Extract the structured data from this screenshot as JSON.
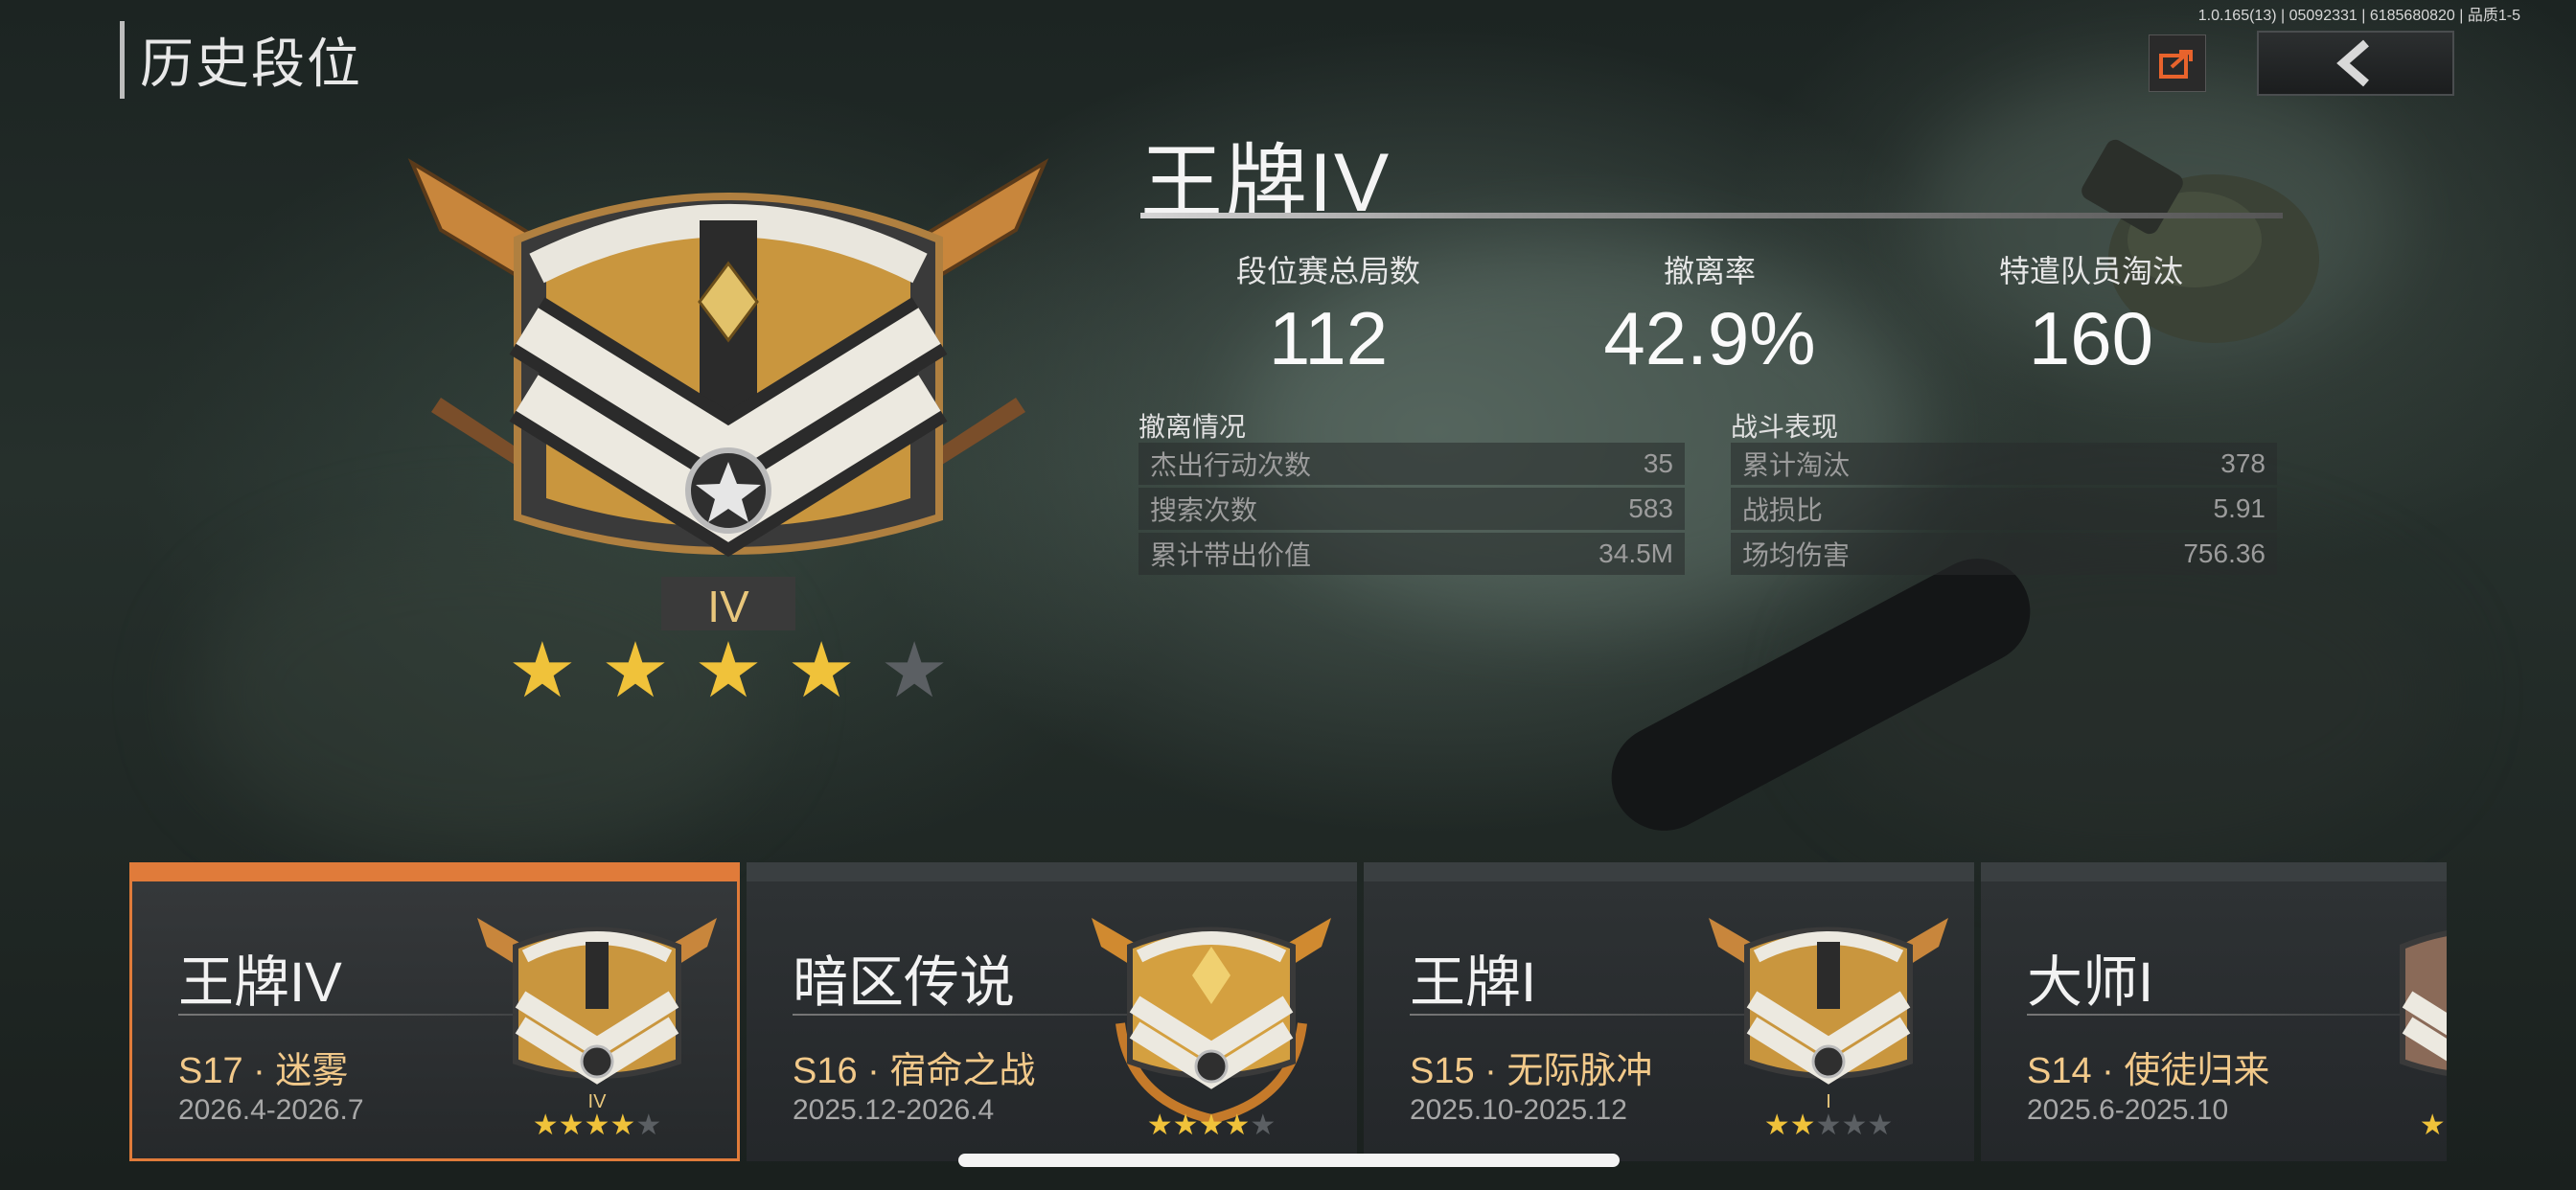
{
  "header": {
    "title": "历史段位",
    "version": "1.0.165(13) | 05092331 | 6185680820 | 品质1-5",
    "share_icon": "share-icon",
    "back_icon": "chevron-left-icon"
  },
  "current_rank": {
    "name": "王牌IV",
    "badge_numeral": "IV",
    "stars_filled": 4,
    "stars_total": 5,
    "stats": [
      {
        "label": "段位赛总局数",
        "value": "112"
      },
      {
        "label": "撤离率",
        "value": "42.9%"
      },
      {
        "label": "特遣队员淘汰",
        "value": "160"
      }
    ],
    "evacuation": {
      "title": "撤离情况",
      "rows": [
        {
          "label": "杰出行动次数",
          "value": "35"
        },
        {
          "label": "搜索次数",
          "value": "583"
        },
        {
          "label": "累计带出价值",
          "value": "34.5M"
        }
      ]
    },
    "combat": {
      "title": "战斗表现",
      "rows": [
        {
          "label": "累计淘汰",
          "value": "378"
        },
        {
          "label": "战损比",
          "value": "5.91"
        },
        {
          "label": "场均伤害",
          "value": "756.36"
        }
      ]
    }
  },
  "seasons": [
    {
      "rank": "王牌IV",
      "season": "S17 · 迷雾",
      "dates": "2026.4-2026.7",
      "numeral": "IV",
      "stars": 4,
      "selected": true
    },
    {
      "rank": "暗区传说",
      "season": "S16 · 宿命之战",
      "dates": "2025.12-2026.4",
      "numeral": "",
      "stars": 4,
      "selected": false
    },
    {
      "rank": "王牌I",
      "season": "S15 · 无际脉冲",
      "dates": "2025.10-2025.12",
      "numeral": "I",
      "stars": 2,
      "selected": false
    },
    {
      "rank": "大师I",
      "season": "S14 · 使徒归来",
      "dates": "2025.6-2025.10",
      "numeral": "",
      "stars": 1,
      "selected": false
    }
  ],
  "colors": {
    "accent": "#e07b3a",
    "gold": "#d9a24a",
    "season_text": "#f2c98a"
  }
}
